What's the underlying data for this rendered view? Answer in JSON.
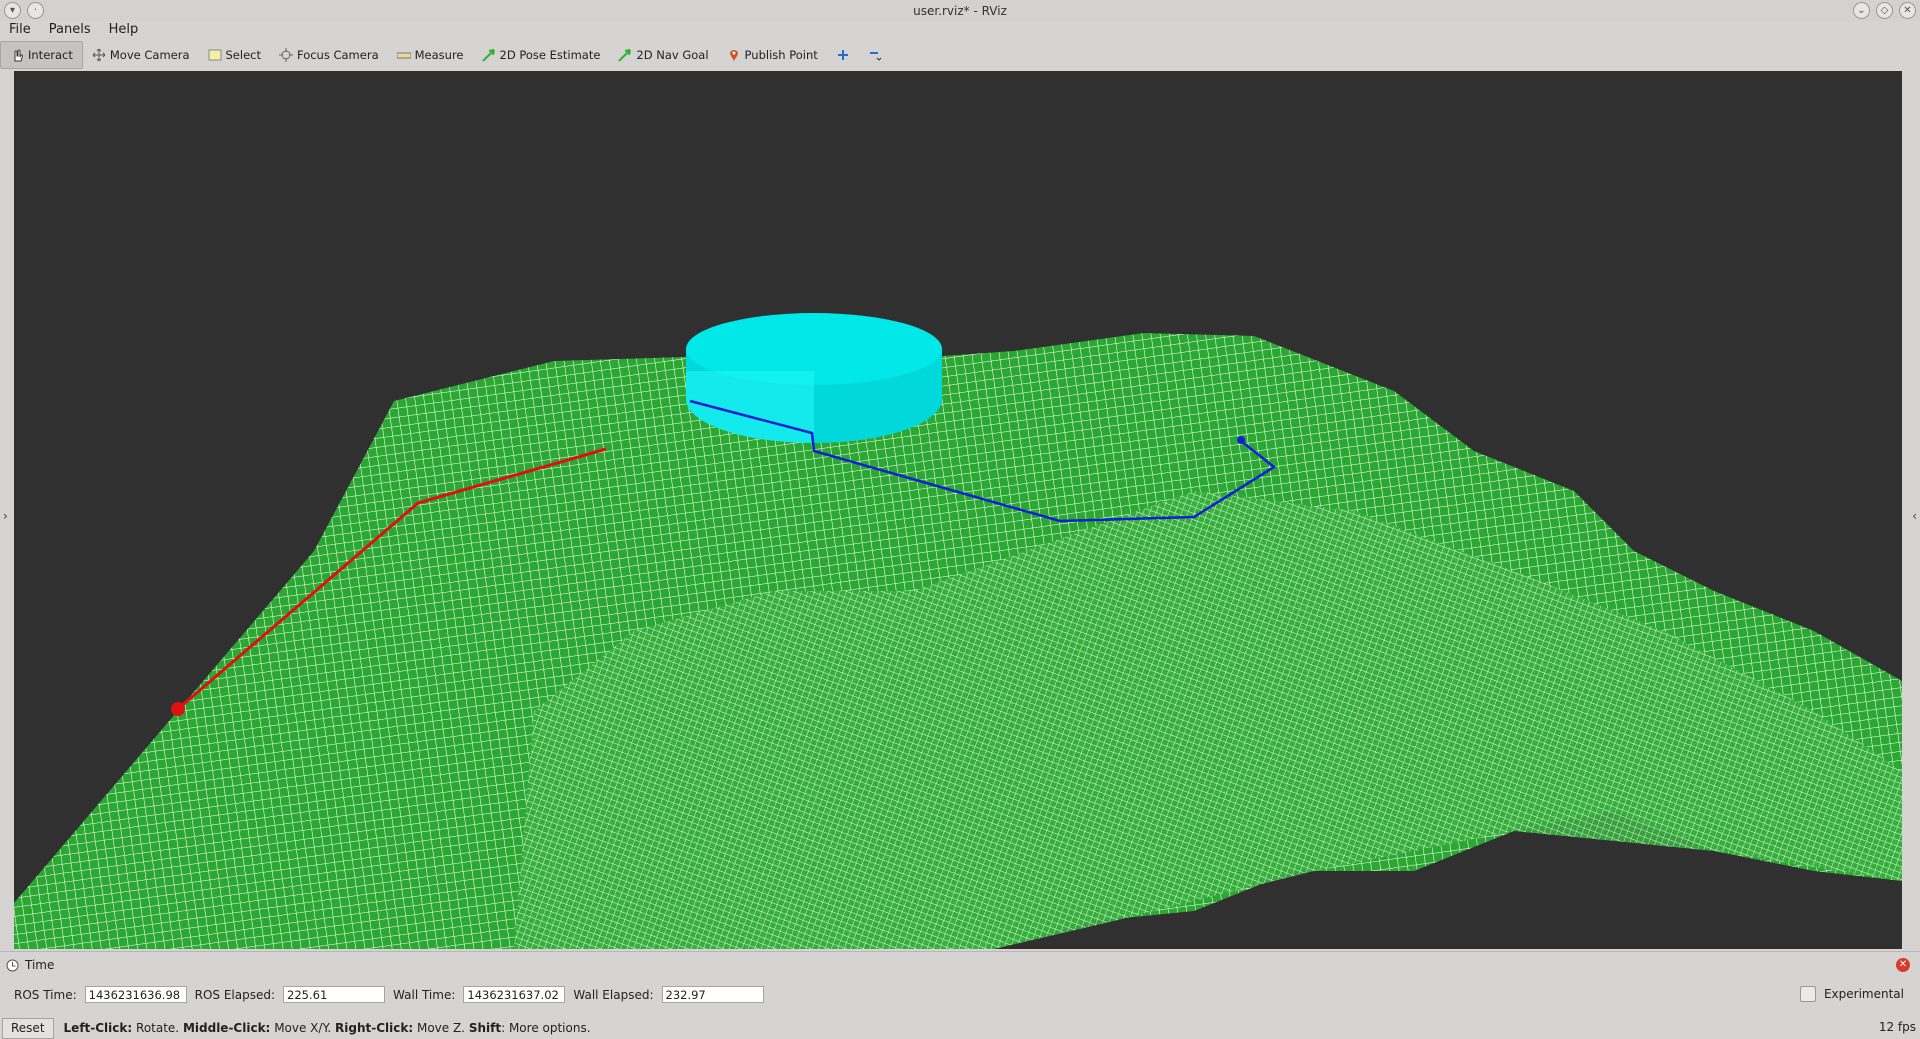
{
  "window": {
    "title": "user.rviz* - RViz"
  },
  "menu": [
    {
      "label": "File"
    },
    {
      "label": "Panels"
    },
    {
      "label": "Help"
    }
  ],
  "tools": {
    "interact": "Interact",
    "move_camera": "Move Camera",
    "select": "Select",
    "focus_camera": "Focus Camera",
    "measure": "Measure",
    "pose_estimate": "2D Pose Estimate",
    "nav_goal": "2D Nav Goal",
    "publish_point": "Publish Point"
  },
  "time_panel": {
    "title": "Time",
    "ros_time_label": "ROS Time:",
    "ros_time": "1436231636.98",
    "ros_elapsed_label": "ROS Elapsed:",
    "ros_elapsed": "225.61",
    "wall_time_label": "Wall Time:",
    "wall_time": "1436231637.02",
    "wall_elapsed_label": "Wall Elapsed:",
    "wall_elapsed": "232.97",
    "experimental_label": "Experimental"
  },
  "status": {
    "reset_label": "Reset",
    "left_click": "Left-Click:",
    "left_click_desc": "Rotate.",
    "middle_click": "Middle-Click:",
    "middle_click_desc": "Move X/Y.",
    "right_click": "Right-Click:",
    "right_click_desc": "Move Z.",
    "shift": "Shift",
    "shift_desc": ": More options.",
    "fps": "12 fps"
  },
  "colors": {
    "background": "#303030",
    "terrain": "#2aa832",
    "grid_lines": "#ffffff",
    "cylinder": "#00e6e6",
    "red_path": "#e01010",
    "blue_path": "#1020d0"
  }
}
